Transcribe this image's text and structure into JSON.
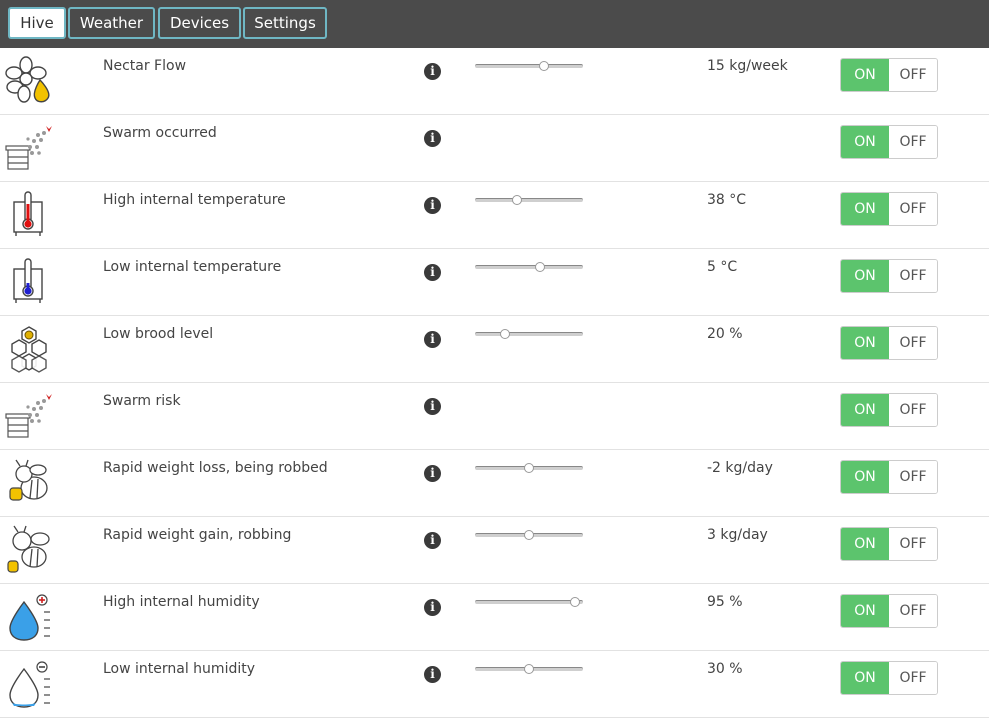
{
  "tabs": [
    {
      "label": "Hive",
      "active": true
    },
    {
      "label": "Weather",
      "active": false
    },
    {
      "label": "Devices",
      "active": false
    },
    {
      "label": "Settings",
      "active": false
    }
  ],
  "toggle": {
    "on_label": "ON",
    "off_label": "OFF"
  },
  "rows": [
    {
      "label": "Nectar Flow",
      "icon": "flower-honey-drop-icon",
      "has_slider": true,
      "slider_level": 0.64,
      "value": "15 kg/week",
      "state": "on"
    },
    {
      "label": "Swarm occurred",
      "icon": "bees-leaving-hive-icon",
      "has_slider": false,
      "value": "",
      "state": "on"
    },
    {
      "label": "High internal temperature",
      "icon": "hive-thermometer-high-icon",
      "has_slider": true,
      "slider_level": 0.39,
      "value": "38 °C",
      "state": "on"
    },
    {
      "label": "Low internal temperature",
      "icon": "hive-thermometer-low-icon",
      "has_slider": true,
      "slider_level": 0.6,
      "value": "5 °C",
      "state": "on"
    },
    {
      "label": "Low brood level",
      "icon": "honeycomb-icon",
      "has_slider": true,
      "slider_level": 0.28,
      "value": "20 %",
      "state": "on"
    },
    {
      "label": "Swarm risk",
      "icon": "bees-leaving-hive-icon",
      "has_slider": false,
      "value": "",
      "state": "on"
    },
    {
      "label": "Rapid weight loss, being robbed",
      "icon": "bee-carrying-honey-icon",
      "has_slider": true,
      "slider_level": 0.5,
      "value": "-2 kg/day",
      "state": "on"
    },
    {
      "label": "Rapid weight gain, robbing",
      "icon": "bee-flying-honey-icon",
      "has_slider": true,
      "slider_level": 0.5,
      "value": "3 kg/day",
      "state": "on"
    },
    {
      "label": "High internal humidity",
      "icon": "water-drop-plus-icon",
      "has_slider": true,
      "slider_level": 0.93,
      "value": "95 %",
      "state": "on"
    },
    {
      "label": "Low internal humidity",
      "icon": "water-drop-minus-icon",
      "has_slider": true,
      "slider_level": 0.5,
      "value": "30 %",
      "state": "on"
    }
  ],
  "colors": {
    "topbar": "#4b4b4b",
    "tab_border": "#6fb7c4",
    "on": "#5cc46d",
    "thermo_high": "#e01010",
    "thermo_low": "#2020d0",
    "humidity": "#3aa0e8",
    "honey": "#f2c200"
  }
}
